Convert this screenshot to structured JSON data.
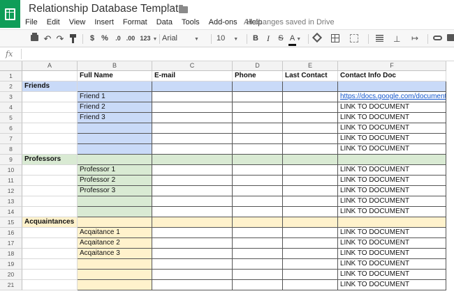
{
  "header": {
    "title": "Relationship Database Template",
    "save_status": "All changes saved in Drive"
  },
  "menu": [
    "File",
    "Edit",
    "View",
    "Insert",
    "Format",
    "Data",
    "Tools",
    "Add-ons",
    "Help"
  ],
  "toolbar": {
    "currency": "$",
    "percent": "%",
    "decrease_decimals": ".0",
    "increase_decimals": ".00",
    "more_formats": "123",
    "font": "Arial",
    "font_size": "10",
    "bold": "B",
    "italic": "I",
    "strikethrough": "S",
    "text_color": "A"
  },
  "formula": {
    "icon": "fx",
    "value": ""
  },
  "columns": [
    "A",
    "B",
    "C",
    "D",
    "E",
    "F"
  ],
  "colors": {
    "friends": "#c9daf8",
    "professors": "#d9ead3",
    "acquaintances": "#fff2cc",
    "link": "#1155cc",
    "logo": "#0f9d58"
  },
  "rows": [
    {
      "num": "1",
      "group": "",
      "cells": [
        "",
        "Full Name",
        "E-mail",
        "Phone",
        "Last Contact",
        "Contact Info Doc"
      ]
    },
    {
      "num": "2",
      "group": "friends",
      "cells": [
        "Friends",
        "",
        "",
        "",
        "",
        ""
      ]
    },
    {
      "num": "3",
      "group": "friends",
      "cells": [
        "",
        "Friend 1",
        "",
        "",
        "",
        "https://docs.google.com/document/d/"
      ]
    },
    {
      "num": "4",
      "group": "friends",
      "cells": [
        "",
        "Friend 2",
        "",
        "",
        "",
        "LINK TO DOCUMENT"
      ]
    },
    {
      "num": "5",
      "group": "friends",
      "cells": [
        "",
        "Friend 3",
        "",
        "",
        "",
        "LINK TO DOCUMENT"
      ]
    },
    {
      "num": "6",
      "group": "friends",
      "cells": [
        "",
        "",
        "",
        "",
        "",
        "LINK TO DOCUMENT"
      ]
    },
    {
      "num": "7",
      "group": "friends",
      "cells": [
        "",
        "",
        "",
        "",
        "",
        "LINK TO DOCUMENT"
      ]
    },
    {
      "num": "8",
      "group": "friends",
      "cells": [
        "",
        "",
        "",
        "",
        "",
        "LINK TO DOCUMENT"
      ]
    },
    {
      "num": "9",
      "group": "professors",
      "cells": [
        "Professors",
        "",
        "",
        "",
        "",
        ""
      ]
    },
    {
      "num": "10",
      "group": "professors",
      "cells": [
        "",
        "Professor 1",
        "",
        "",
        "",
        "LINK TO DOCUMENT"
      ]
    },
    {
      "num": "11",
      "group": "professors",
      "cells": [
        "",
        "Professor 2",
        "",
        "",
        "",
        "LINK TO DOCUMENT"
      ]
    },
    {
      "num": "12",
      "group": "professors",
      "cells": [
        "",
        "Professor 3",
        "",
        "",
        "",
        "LINK TO DOCUMENT"
      ]
    },
    {
      "num": "13",
      "group": "professors",
      "cells": [
        "",
        "",
        "",
        "",
        "",
        "LINK TO DOCUMENT"
      ]
    },
    {
      "num": "14",
      "group": "professors",
      "cells": [
        "",
        "",
        "",
        "",
        "",
        "LINK TO DOCUMENT"
      ]
    },
    {
      "num": "15",
      "group": "acquaintances",
      "cells": [
        "Acquaintances",
        "",
        "",
        "",
        "",
        ""
      ]
    },
    {
      "num": "16",
      "group": "acquaintances",
      "cells": [
        "",
        "Acqaitance 1",
        "",
        "",
        "",
        "LINK TO DOCUMENT"
      ]
    },
    {
      "num": "17",
      "group": "acquaintances",
      "cells": [
        "",
        "Acqaitance 2",
        "",
        "",
        "",
        "LINK TO DOCUMENT"
      ]
    },
    {
      "num": "18",
      "group": "acquaintances",
      "cells": [
        "",
        "Acqaitance 3",
        "",
        "",
        "",
        "LINK TO DOCUMENT"
      ]
    },
    {
      "num": "19",
      "group": "acquaintances",
      "cells": [
        "",
        "",
        "",
        "",
        "",
        "LINK TO DOCUMENT"
      ]
    },
    {
      "num": "20",
      "group": "acquaintances",
      "cells": [
        "",
        "",
        "",
        "",
        "",
        "LINK TO DOCUMENT"
      ]
    },
    {
      "num": "21",
      "group": "acquaintances",
      "cells": [
        "",
        "",
        "",
        "",
        "",
        "LINK TO DOCUMENT"
      ]
    }
  ]
}
